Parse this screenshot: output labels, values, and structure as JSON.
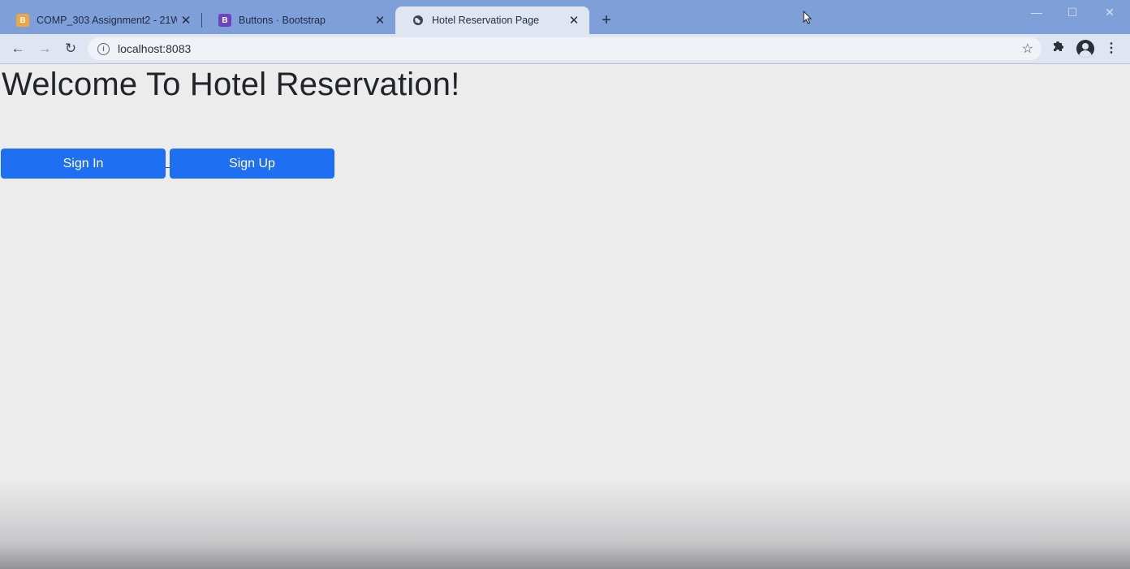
{
  "tabs": [
    {
      "title": "COMP_303 Assignment2 - 21W -",
      "favicon": "bootstrap-orange-icon"
    },
    {
      "title": "Buttons · Bootstrap",
      "favicon": "bootstrap-purple-icon"
    },
    {
      "title": "Hotel Reservation Page",
      "favicon": "globe-icon",
      "active": true
    }
  ],
  "favicon_letters": {
    "bootstrap": "B"
  },
  "address_bar": {
    "url": "localhost:8083"
  },
  "page": {
    "heading": "Welcome To Hotel Reservation!",
    "sign_in_label": "Sign In",
    "sign_up_label": "Sign Up"
  },
  "colors": {
    "primary_button": "#1e6ff1",
    "tabstrip": "#7e9fd8",
    "page_background": "#ececed"
  }
}
